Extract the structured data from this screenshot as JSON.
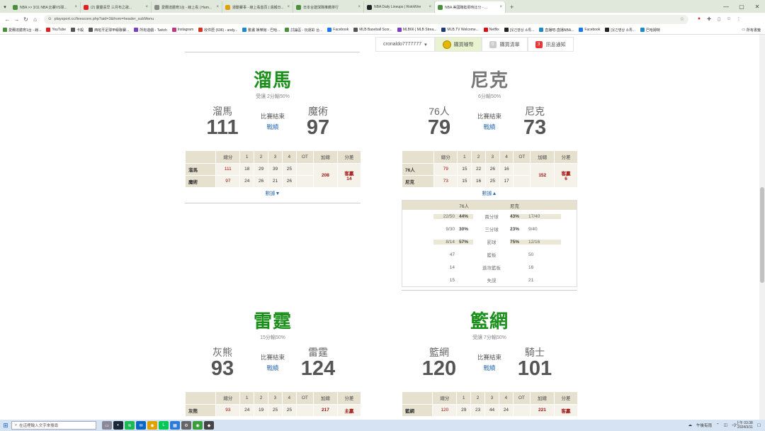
{
  "browser": {
    "tabs": [
      {
        "title": "NBA >> 3/11 NBA 比賽VS球...",
        "color": "#4a8f3a",
        "active": false
      },
      {
        "title": "(2) 靈靈喜早 三月布之歌...",
        "color": "#e02020",
        "active": false
      },
      {
        "title": "愛爾達體育1台 - 線上看 | Ham...",
        "color": "#888888",
        "active": false
      },
      {
        "title": "運動賽事 - 線上看首頁 | 週報日...",
        "color": "#e0a000",
        "active": false
      },
      {
        "title": "日本合建球隊推薦排行",
        "color": "#4a8f3a",
        "active": false
      },
      {
        "title": "NBA Daily Lineups | RotoWire",
        "color": "#222222",
        "active": false
      },
      {
        "title": "NBA 美國職籃即時比分 - ...",
        "color": "#4a8f3a",
        "active": true
      }
    ],
    "new_tab": "+",
    "url": "playsport.cc/livescore.php?aid=3&from=header_subMenu",
    "bookmarks": [
      {
        "label": "愛爾達體育1台 - 線...",
        "color": "#4a8f3a"
      },
      {
        "label": "YouTube",
        "color": "#e02020"
      },
      {
        "label": "卡殺",
        "color": "#555555"
      },
      {
        "label": "西班牙足球甲級聯賽...",
        "color": "#555555"
      },
      {
        "label": "所有遊戲 - Twitch",
        "color": "#7b3fc4"
      },
      {
        "label": "Instagram",
        "color": "#c13584"
      },
      {
        "label": "收件匣 (696) - andy...",
        "color": "#d93025"
      },
      {
        "label": "動畫 娛樂館 - 巴哈...",
        "color": "#1e88c8"
      },
      {
        "label": "討論區 - 玩運彩 台...",
        "color": "#4a8f3a"
      },
      {
        "label": "Facebook",
        "color": "#1877f2"
      },
      {
        "label": "MLB Baseball Scor...",
        "color": "#555555"
      },
      {
        "label": "MLB66 | MLB Strea...",
        "color": "#7b3fc4"
      },
      {
        "label": "MLB.TV Welcome...",
        "color": "#1c3a7a"
      },
      {
        "label": "Netflix",
        "color": "#e50914"
      },
      {
        "label": "[웃긴영상 소튜...",
        "color": "#222222"
      },
      {
        "label": "直播吧-直播NBA...",
        "color": "#1e88c8"
      },
      {
        "label": "Facebook",
        "color": "#1877f2"
      },
      {
        "label": "[웃긴영상 소튜...",
        "color": "#222222"
      },
      {
        "label": "巴哈姆特",
        "color": "#1e88c8"
      }
    ],
    "bookmarks_right": "所有書籤"
  },
  "userbar": {
    "username": "cronaldo7777777",
    "buy_label": "購買噱幣",
    "watchlist_count": "0",
    "watchlist_label": "購買清單",
    "notify_count": "3",
    "notify_label": "訊息通知"
  },
  "games": [
    {
      "winner_title": "溜馬",
      "title_color": "green",
      "subtitle": "受讓 2分輸50%",
      "team_a": "溜馬",
      "score_a": "111",
      "team_b": "魔術",
      "score_b": "97",
      "status": "比賽結束",
      "report_link": "戰績",
      "headers": [
        "總分",
        "1",
        "2",
        "3",
        "4",
        "OT",
        "加總",
        "分差"
      ],
      "rows": [
        {
          "team": "溜馬",
          "total": "111",
          "q": [
            "18",
            "29",
            "39",
            "25"
          ],
          "ot": ""
        },
        {
          "team": "魔術",
          "total": "97",
          "q": [
            "24",
            "26",
            "21",
            "26"
          ],
          "ot": ""
        }
      ],
      "sum": "208",
      "diff_label": "客贏",
      "diff_value": "14",
      "toggle": "數據▼"
    },
    {
      "winner_title": "尼克",
      "title_color": "gray",
      "subtitle": "6分輸50%",
      "team_a": "76人",
      "score_a": "79",
      "team_b": "尼克",
      "score_b": "73",
      "status": "比賽結束",
      "report_link": "戰績",
      "headers": [
        "總分",
        "1",
        "2",
        "3",
        "4",
        "OT",
        "加總",
        "分差"
      ],
      "rows": [
        {
          "team": "76人",
          "total": "79",
          "q": [
            "15",
            "22",
            "26",
            "16"
          ],
          "ot": ""
        },
        {
          "team": "尼克",
          "total": "73",
          "q": [
            "15",
            "16",
            "25",
            "17"
          ],
          "ot": ""
        }
      ],
      "sum": "152",
      "diff_label": "客贏",
      "diff_value": "6",
      "toggle": "數據▲",
      "stats": {
        "team_a": "76人",
        "team_b": "尼克",
        "rows": [
          {
            "a": "22/50",
            "ap": "44%",
            "label": "兩分球",
            "bp": "43%",
            "b": "17/40",
            "hl": true
          },
          {
            "a": "9/30",
            "ap": "30%",
            "label": "三分球",
            "bp": "23%",
            "b": "9/40",
            "hl": false
          },
          {
            "a": "8/14",
            "ap": "57%",
            "label": "罰球",
            "bp": "75%",
            "b": "12/16",
            "hl": true
          },
          {
            "a": "47",
            "ap": "",
            "label": "籃板",
            "bp": "",
            "b": "50",
            "hl": false
          },
          {
            "a": "14",
            "ap": "",
            "label": "進攻籃板",
            "bp": "",
            "b": "16",
            "hl": false
          },
          {
            "a": "15",
            "ap": "",
            "label": "失誤",
            "bp": "",
            "b": "21",
            "hl": false
          }
        ]
      }
    },
    {
      "winner_title": "雷霆",
      "title_color": "green",
      "subtitle": "15分輸50%",
      "team_a": "灰熊",
      "score_a": "93",
      "team_b": "雷霆",
      "score_b": "124",
      "status": "比賽結束",
      "report_link": "戰績",
      "headers": [
        "總分",
        "1",
        "2",
        "3",
        "4",
        "OT",
        "加總",
        "分差"
      ],
      "rows": [
        {
          "team": "灰熊",
          "total": "93",
          "q": [
            "24",
            "19",
            "25",
            "25"
          ],
          "ot": ""
        }
      ],
      "sum": "217",
      "diff_label": "主贏",
      "diff_value": ""
    },
    {
      "winner_title": "籃網",
      "title_color": "green",
      "subtitle": "受讓 7分輸50%",
      "team_a": "籃網",
      "score_a": "120",
      "team_b": "騎士",
      "score_b": "101",
      "status": "比賽結束",
      "report_link": "戰績",
      "headers": [
        "總分",
        "1",
        "2",
        "3",
        "4",
        "OT",
        "加總",
        "分差"
      ],
      "rows": [
        {
          "team": "籃網",
          "total": "120",
          "q": [
            "29",
            "23",
            "44",
            "24"
          ],
          "ot": ""
        }
      ],
      "sum": "221",
      "diff_label": "客贏",
      "diff_value": ""
    }
  ],
  "taskbar": {
    "search_placeholder": "在這裡輸入文字來搜尋",
    "weather": "午後有雨",
    "time": "上午 03:38",
    "date": "2024/3/11"
  }
}
